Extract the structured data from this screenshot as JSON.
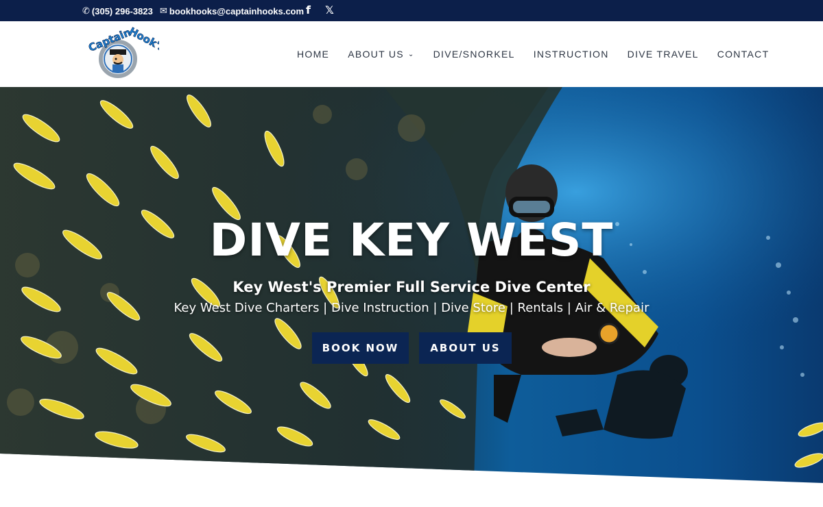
{
  "topbar": {
    "phone": "(305) 296-3823",
    "email": "bookhooks@captainhooks.com",
    "facebook_icon": "facebook-icon",
    "x_icon": "x-icon"
  },
  "header": {
    "logo_text": "Captain Hook's",
    "nav": {
      "home": "HOME",
      "about": "ABOUT US",
      "dive": "DIVE/SNORKEL",
      "instruction": "INSTRUCTION",
      "travel": "DIVE TRAVEL",
      "contact": "CONTACT"
    }
  },
  "hero": {
    "title": "DIVE KEY WEST",
    "subtitle": "Key West's Premier Full Service Dive Center",
    "services": "Key West Dive Charters | Dive Instruction | Dive Store | Rentals | Air & Repair",
    "book_button": "BOOK NOW",
    "about_button": "ABOUT US"
  },
  "colors": {
    "topbar": "#0c1f4a",
    "button": "#0b2553",
    "nav_text": "#2b3442"
  }
}
